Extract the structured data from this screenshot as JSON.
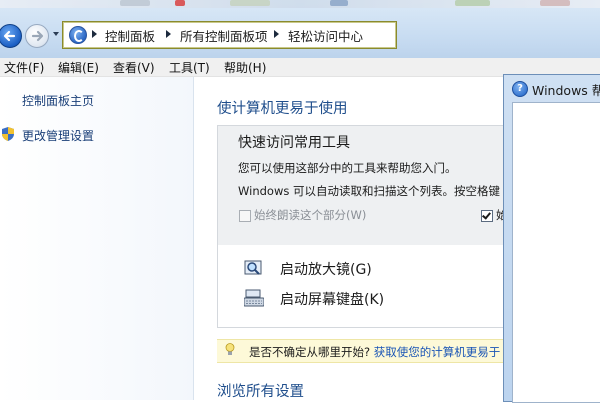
{
  "address": {
    "crumbs": [
      "控制面板",
      "所有控制面板项",
      "轻松访问中心"
    ]
  },
  "menu": {
    "items": [
      "文件(F)",
      "编辑(E)",
      "查看(V)",
      "工具(T)",
      "帮助(H)"
    ]
  },
  "sidebar": {
    "home_link": "控制面板主页",
    "manage_link": "更改管理设置"
  },
  "main": {
    "title": "使计算机更易于使用",
    "tools_panel": {
      "title": "快速访问常用工具",
      "description": "您可以使用这部分中的工具来帮助您入门。",
      "scan_text": "Windows 可以自动读取和扫描这个列表。按空格键",
      "always_read_label": "始终朗读这个部分(W)",
      "always_read_checked": false,
      "right_checkbox_label": "始",
      "right_checkbox_checked": true
    },
    "tools": [
      {
        "label": "启动放大镜(G)",
        "icon": "magnifier-icon"
      },
      {
        "label": "启动屏幕键盘(K)",
        "icon": "keyboard-icon"
      }
    ],
    "hint": {
      "question": "是否不确定从哪里开始?",
      "link": "获取使您的计算机更易于"
    },
    "browse_title": "浏览所有设置"
  },
  "help_window": {
    "title": "Windows 帮"
  },
  "colors": {
    "link": "#1a3f78",
    "heading": "#1f4e8c",
    "hint_bg": "#fdf9d8",
    "panel_bg": "#eef0f2"
  }
}
